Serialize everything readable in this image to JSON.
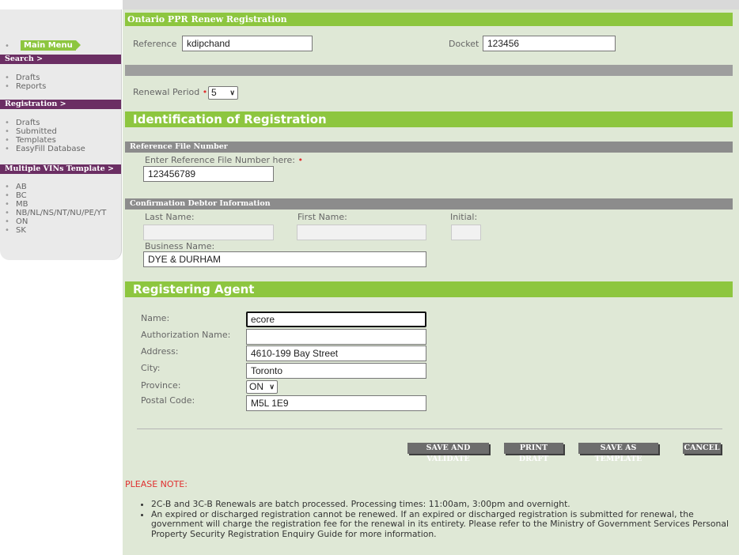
{
  "sidebar": {
    "main_menu": "Main Menu",
    "search_header": "Search >",
    "search_items": [
      "Drafts",
      "Reports"
    ],
    "registration_header": "Registration >",
    "registration_items": [
      "Drafts",
      "Submitted",
      "Templates",
      "EasyFill Database"
    ],
    "vins_header": "Multiple VINs Template >",
    "vins_items": [
      "AB",
      "BC",
      "MB",
      "NB/NL/NS/NT/NU/PE/YT",
      "ON",
      "SK"
    ]
  },
  "form": {
    "title": "Ontario PPR Renew Registration",
    "reference_label": "Reference",
    "reference_value": "kdipchand",
    "docket_label": "Docket",
    "docket_value": "123456",
    "renewal_label": "Renewal Period",
    "renewal_value": "5",
    "required_mark": "•"
  },
  "identification": {
    "heading": "Identification of Registration",
    "ref_file_header": "Reference File Number",
    "ref_file_label": "Enter Reference File Number here:",
    "ref_file_value": "123456789",
    "debtor_header": "Confirmation Debtor Information",
    "last_name_label": "Last Name:",
    "first_name_label": "First Name:",
    "initial_label": "Initial:",
    "business_label": "Business Name:",
    "business_value": "DYE & DURHAM"
  },
  "agent": {
    "heading": "Registering Agent",
    "name_label": "Name:",
    "name_value": "ecore",
    "auth_label": "Authorization Name:",
    "auth_value": "",
    "address_label": "Address:",
    "address_value": "4610-199 Bay Street",
    "city_label": "City:",
    "city_value": "Toronto",
    "province_label": "Province:",
    "province_value": "ON",
    "postal_label": "Postal Code:",
    "postal_value": "M5L 1E9"
  },
  "buttons": {
    "save_validate": "SAVE AND VALIDATE",
    "print_draft": "PRINT DRAFT",
    "save_template": "SAVE AS TEMPLATE",
    "cancel": "CANCEL"
  },
  "notes": {
    "title": "PLEASE NOTE:",
    "items": [
      "2C-B and 3C-B Renewals are batch processed. Processing times: 11:00am, 3:00pm and overnight.",
      "An expired or discharged registration cannot be renewed. If an expired or discharged registration is submitted for renewal, the government will charge the registration fee for the renewal in its entirety. Please refer to the Ministry of Government Services Personal Property Security Registration Enquiry Guide for more information."
    ]
  },
  "colors": {
    "accent_green": "#8dc63f",
    "sidebar_purple": "#6b2e63",
    "panel_bg": "#dfe8d6",
    "required_red": "#e03030"
  }
}
